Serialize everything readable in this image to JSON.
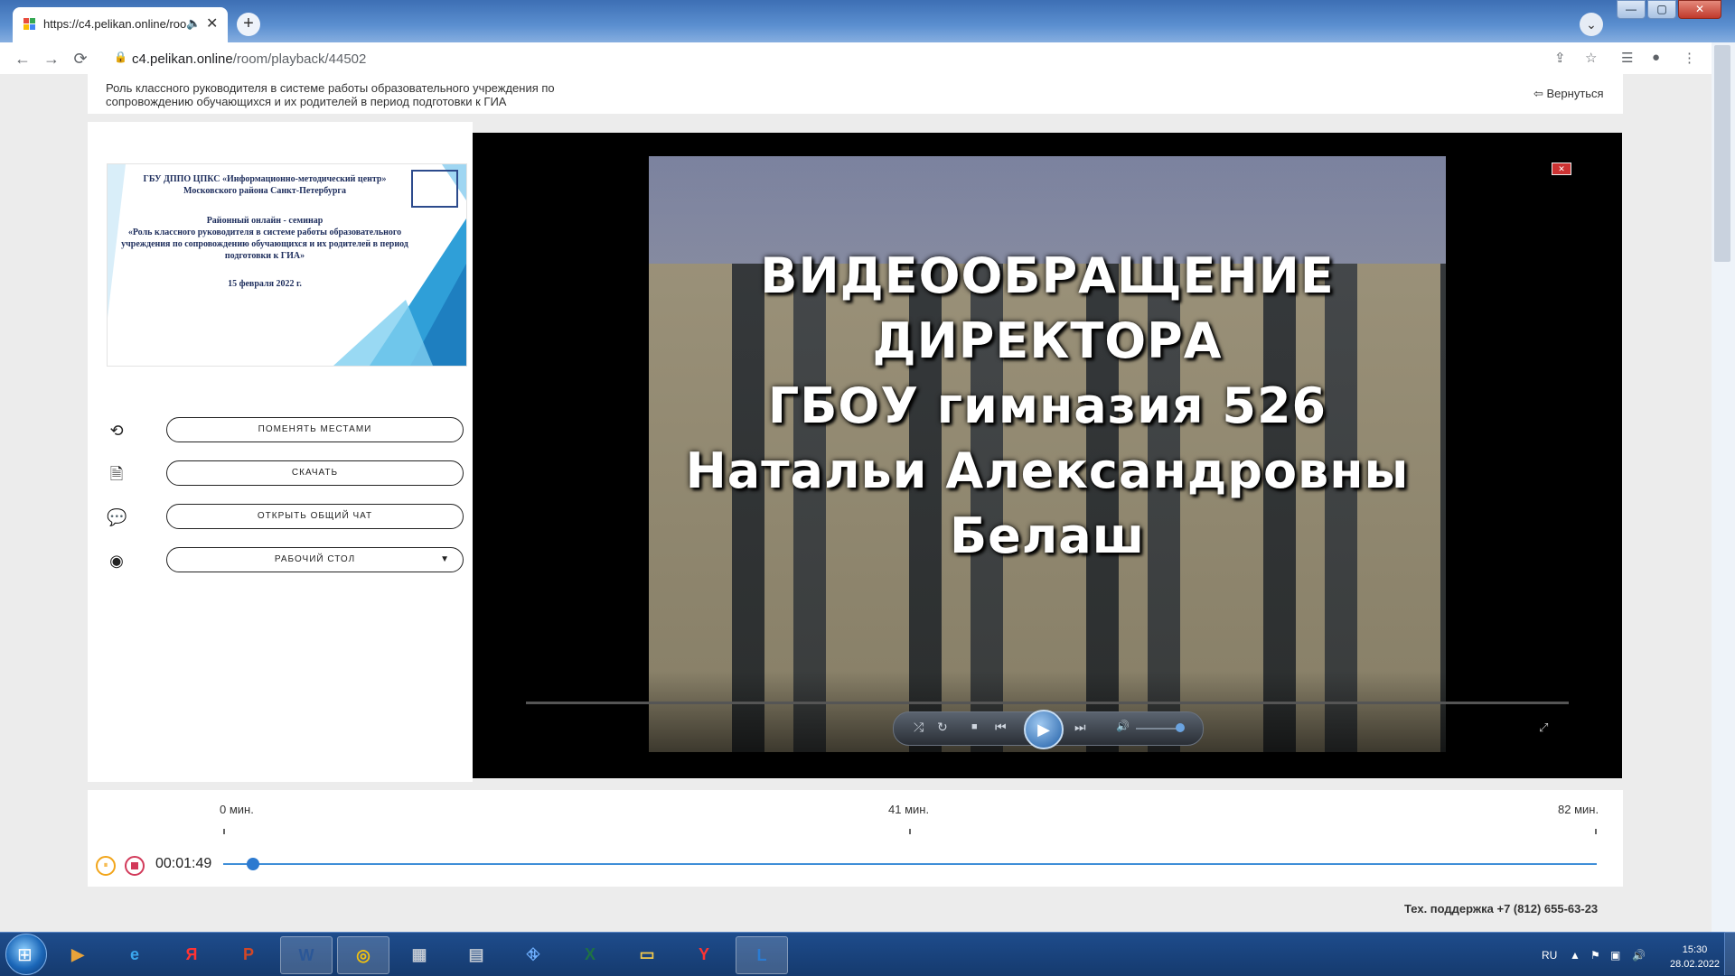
{
  "browser": {
    "tab_title": "https://c4.pelikan.online/roo",
    "tab_audio_icon": "speaker-icon",
    "close_glyph": "✕",
    "new_tab_glyph": "+",
    "tab_menu_glyph": "⌄",
    "window": {
      "minimize": "—",
      "maximize": "▢",
      "close": "✕"
    },
    "url_host": "c4.pelikan.online",
    "url_path": "/room/playback/44502",
    "nav": {
      "back": "←",
      "forward": "→",
      "reload": "⟳"
    },
    "toolbar_icons": {
      "share": "⇪",
      "star": "☆",
      "reading_list": "☰",
      "profile": "●",
      "menu": "⋮"
    }
  },
  "header": {
    "title": "Роль классного руководителя в системе работы образовательного учреждения по сопровождению обучающихся и их родителей в период подготовки к ГИА",
    "back_label": "Вернуться",
    "back_icon": "exit-icon"
  },
  "slide": {
    "org": "ГБУ ДППО ЦПКС «Информационно-методический центр» Московского района Санкт-Петербурга",
    "event": "Районный онлайн - семинар",
    "topic": "«Роль классного руководителя в системе работы образовательного учреждения по сопровождению обучающихся и их родителей в период подготовки к ГИА»",
    "date": "15 февраля 2022 г."
  },
  "actions": [
    {
      "label": "ПОМЕНЯТЬ МЕСТАМИ",
      "icon": "swap-icon",
      "glyph": "⟲"
    },
    {
      "label": "СКАЧАТЬ",
      "icon": "document-icon",
      "glyph": "🗎"
    },
    {
      "label": "ОТКРЫТЬ ОБЩИЙ ЧАТ",
      "icon": "chat-bubble-icon",
      "glyph": "💬"
    },
    {
      "label": "РАБОЧИЙ СТОЛ",
      "icon": "webcam-icon",
      "glyph": "◉",
      "caret": "▼"
    }
  ],
  "video": {
    "caption_lines": [
      "ВИДЕООБРАЩЕНИЕ",
      "ДИРЕКТОРА",
      "ГБОУ гимназия 526",
      "Натальи Александровны",
      "Белаш"
    ],
    "close_glyph": "✕",
    "fullscreen_glyph": "⤢",
    "controls": {
      "shuffle": "⤮",
      "repeat": "↻",
      "stop": "■",
      "prev": "⏮",
      "play": "▶",
      "next": "⏭",
      "volume": "🔊"
    }
  },
  "timeline": {
    "labels": [
      "0 мин.",
      "41 мин.",
      "82 мин."
    ],
    "current_time": "00:01:49",
    "progress": 0.022,
    "pause_glyph": "⏸"
  },
  "footer": {
    "support": "Тех. поддержка +7 (812) 655-63-23"
  },
  "taskbar": {
    "apps": [
      {
        "name": "media-player-icon",
        "glyph": "▶",
        "color": "#e8a33a"
      },
      {
        "name": "internet-explorer-icon",
        "glyph": "e",
        "color": "#3aa7ee"
      },
      {
        "name": "yandex-browser-icon",
        "glyph": "Я",
        "color": "#ff3333"
      },
      {
        "name": "powerpoint-icon",
        "glyph": "P",
        "color": "#d24726"
      },
      {
        "name": "word-icon",
        "glyph": "W",
        "color": "#2b5797"
      },
      {
        "name": "chrome-icon",
        "glyph": "◎",
        "color": "#f4c20d"
      },
      {
        "name": "calculator-icon",
        "glyph": "▦",
        "color": "#c0c8d2"
      },
      {
        "name": "scanner-icon",
        "glyph": "▤",
        "color": "#c0c8d2"
      },
      {
        "name": "network-icon",
        "glyph": "⛗",
        "color": "#6fb0ff"
      },
      {
        "name": "excel-icon",
        "glyph": "X",
        "color": "#1e7145"
      },
      {
        "name": "explorer-folder-icon",
        "glyph": "▭",
        "color": "#f2c94c"
      },
      {
        "name": "yandex-icon",
        "glyph": "Y",
        "color": "#ff3333"
      },
      {
        "name": "lync-icon",
        "glyph": "L",
        "color": "#2b7cd3"
      }
    ],
    "lang": "RU",
    "tray_icons": {
      "arrow": "▲",
      "flag": "⚑",
      "network": "▣",
      "volume": "🔊"
    },
    "time": "15:30",
    "date": "28.02.2022"
  },
  "colors": {
    "accent_blue": "#2d7ad0",
    "pause_orange": "#f2a51a",
    "stop_red": "#d23a5a"
  }
}
